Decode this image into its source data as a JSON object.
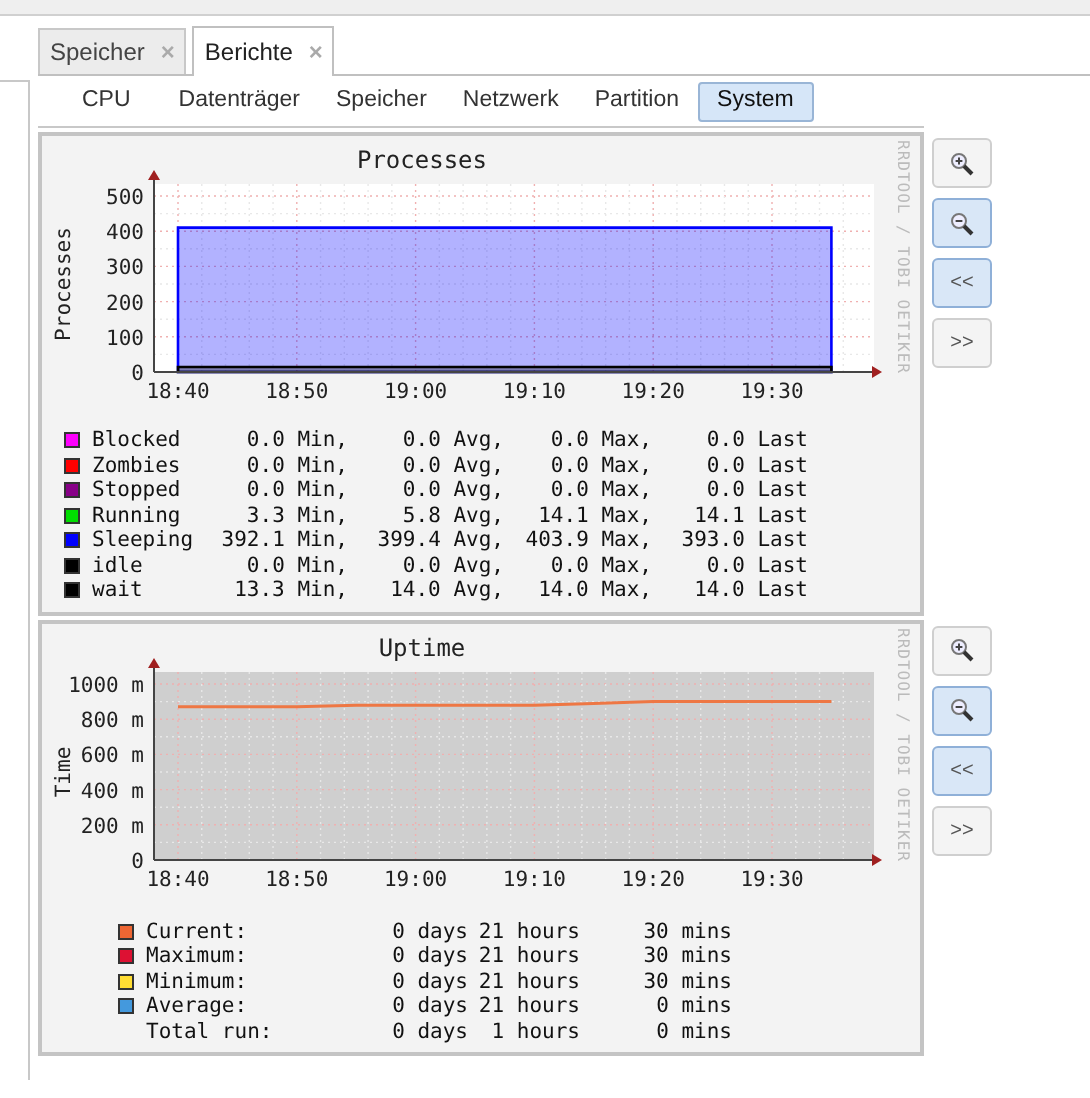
{
  "tabs": [
    {
      "label": "Speicher",
      "close": "×",
      "selected": false
    },
    {
      "label": "Berichte",
      "close": "×",
      "selected": true
    }
  ],
  "subtabs": [
    {
      "label": "CPU",
      "selected": false
    },
    {
      "label": "Datenträger",
      "selected": false
    },
    {
      "label": "Speicher",
      "selected": false
    },
    {
      "label": "Netzwerk",
      "selected": false
    },
    {
      "label": "Partition",
      "selected": false
    },
    {
      "label": "System",
      "selected": true
    }
  ],
  "graphs": [
    {
      "watermark": "RRDTOOL / TOBI OETIKER",
      "chart_data": {
        "type": "area",
        "title": "Processes",
        "ylabel": "Processes",
        "grid": true,
        "categories": [
          "18:40",
          null,
          "18:50",
          null,
          "19:00",
          null,
          "19:10",
          null,
          "19:20",
          null,
          "19:30",
          null
        ],
        "ylim": [
          0,
          500
        ],
        "yticks": [
          0,
          100,
          200,
          300,
          400,
          500
        ],
        "series": [
          {
            "color": "#0000ff",
            "values": [
              410,
              410,
              410,
              410,
              410,
              410,
              410,
              410,
              410,
              410,
              410,
              410
            ]
          },
          {
            "color": "#000000",
            "values": [
              14,
              14,
              14,
              14,
              14,
              14,
              14,
              14,
              14,
              14,
              14,
              14
            ]
          }
        ]
      },
      "legend": [
        {
          "name": "Blocked",
          "color": "#ff00ff",
          "cols": [
            "0.0 Min,",
            "0.0 Avg,",
            "0.0 Max,",
            "0.0 Last"
          ]
        },
        {
          "name": "Zombies",
          "color": "#ff0000",
          "cols": [
            "0.0 Min,",
            "0.0 Avg,",
            "0.0 Max,",
            "0.0 Last"
          ]
        },
        {
          "name": "Stopped",
          "color": "#880088",
          "cols": [
            "0.0 Min,",
            "0.0 Avg,",
            "0.0 Max,",
            "0.0 Last"
          ]
        },
        {
          "name": "Running",
          "color": "#00dd00",
          "cols": [
            "3.3 Min,",
            "5.8 Avg,",
            "14.1 Max,",
            "14.1 Last"
          ]
        },
        {
          "name": "Sleeping",
          "color": "#0000ff",
          "cols": [
            "392.1 Min,",
            "399.4 Avg,",
            "403.9 Max,",
            "393.0 Last"
          ]
        },
        {
          "name": "idle",
          "color": "#000000",
          "cols": [
            "0.0 Min,",
            "0.0 Avg,",
            "0.0 Max,",
            "0.0 Last"
          ]
        },
        {
          "name": "wait",
          "color": "#000000",
          "cols": [
            "13.3 Min,",
            "14.0 Avg,",
            "14.0 Max,",
            "14.0 Last"
          ]
        }
      ],
      "buttons": [
        {
          "kind": "zoom-in",
          "active": false
        },
        {
          "kind": "zoom-out",
          "active": true
        },
        {
          "kind": "text",
          "label": "<<",
          "active": true
        },
        {
          "kind": "text",
          "label": ">>",
          "active": false
        }
      ]
    },
    {
      "watermark": "RRDTOOL / TOBI OETIKER",
      "chart_data": {
        "type": "line",
        "title": "Uptime",
        "ylabel": "Time",
        "grid": true,
        "categories": [
          "18:40",
          null,
          "18:50",
          null,
          "19:00",
          null,
          "19:10",
          null,
          "19:20",
          null,
          "19:30",
          null
        ],
        "ylim": [
          0,
          1000
        ],
        "yticks": [
          0,
          {
            "value": 200,
            "label": "200 m"
          },
          {
            "value": 400,
            "label": "400 m"
          },
          {
            "value": 600,
            "label": "600 m"
          },
          {
            "value": 800,
            "label": "800 m"
          },
          {
            "value": 1000,
            "label": "1000 m"
          }
        ],
        "series": [
          {
            "color": "#ee7744",
            "values": [
              870,
              870,
              870,
              880,
              880,
              880,
              880,
              890,
              900,
              900,
              900,
              900
            ]
          }
        ]
      },
      "legend": [
        {
          "name": "Current:",
          "color": "#ee6633",
          "cols": [
            "0 days",
            "21 hours",
            "30 mins"
          ]
        },
        {
          "name": "Maximum:",
          "color": "#dd1133",
          "cols": [
            "0 days",
            "21 hours",
            "30 mins"
          ]
        },
        {
          "name": "Minimum:",
          "color": "#ffdd33",
          "cols": [
            "0 days",
            "21 hours",
            "30 mins"
          ]
        },
        {
          "name": "Average:",
          "color": "#4499dd",
          "cols": [
            "0 days",
            "21 hours",
            "0 mins"
          ]
        },
        {
          "name": "Total run:",
          "cols": [
            "0 days",
            "1 hours",
            "0 mins"
          ]
        }
      ],
      "buttons": [
        {
          "kind": "zoom-in",
          "active": false
        },
        {
          "kind": "zoom-out",
          "active": true
        },
        {
          "kind": "text",
          "label": "<<",
          "active": true
        },
        {
          "kind": "text",
          "label": ">>",
          "active": false
        }
      ]
    }
  ]
}
